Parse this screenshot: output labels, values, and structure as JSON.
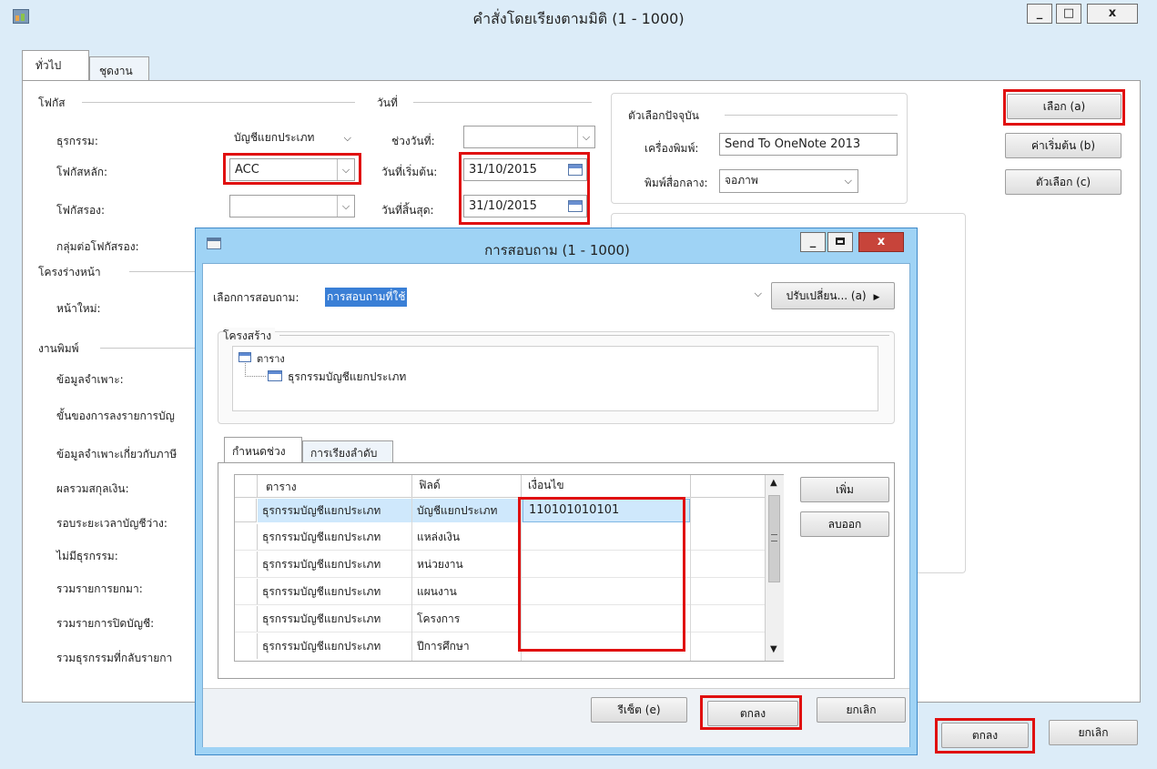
{
  "main_window": {
    "title": "คำสั่งโดยเรียงตามมิติ (1 - 1000)",
    "tabs": [
      "ทั่วไป",
      "ชุดงาน"
    ],
    "focus_group": {
      "title": "โฟกัส",
      "transaction_label": "ธุรกรรม:",
      "transaction_value": "บัญชีแยกประเภท",
      "main_focus_label": "โฟกัสหลัก:",
      "main_focus_value": "ACC",
      "secondary_focus_label": "โฟกัสรอง:",
      "secondary_focus_value": "",
      "sub_focus_group_label": "กลุ่มต่อโฟกัสรอง:"
    },
    "layout_group": {
      "title": "โครงร่างหน้า",
      "new_page_label": "หน้าใหม่:"
    },
    "date_group": {
      "title": "วันที่",
      "interval_label": "ช่วงวันที่:",
      "interval_value": "",
      "start_label": "วันที่เริ่มต้น:",
      "start_value": "31/10/2015",
      "end_label": "วันที่สิ้นสุด:",
      "end_value": "31/10/2015"
    },
    "current_options": {
      "title": "ตัวเลือกปัจจุบัน",
      "printer_label": "เครื่องพิมพ์:",
      "printer_value": "Send To OneNote 2013",
      "print_medium_label": "พิมพ์สื่อกลาง:",
      "print_medium_value": "จอภาพ"
    },
    "print_group": {
      "title": "งานพิมพ์",
      "labels": [
        "ข้อมูลจำเพาะ:",
        "ขั้นของการลงรายการบัญ",
        "ข้อมูลจำเพาะเกี่ยวกับภาษี",
        "ผลรวมสกุลเงิน:",
        "รอบระยะเวลาบัญชีว่าง:",
        "ไม่มีธุรกรรม:",
        "รวมรายการยกมา:",
        "รวมรายการปิดบัญชี:",
        "รวมธุรกรรมที่กลับรายกา"
      ]
    },
    "side_buttons": {
      "select": "เลือก (a)",
      "defaults": "ค่าเริ่มต้น (b)",
      "options": "ตัวเลือก (c)"
    },
    "footer": {
      "ok": "ตกลง",
      "cancel": "ยกเลิก"
    }
  },
  "dialog": {
    "title": "การสอบถาม (1 - 1000)",
    "select_query_label": "เลือกการสอบถาม:",
    "select_query_value": "การสอบถามที่ใช้",
    "modify_button": "ปรับเปลี่ยน... (a)",
    "structure_title": "โครงสร้าง",
    "tree": {
      "root": "ตาราง",
      "child": "ธุรกรรมบัญชีแยกประเภท"
    },
    "tabs": [
      "กำหนดช่วง",
      "การเรียงลำดับ"
    ],
    "grid": {
      "headers": [
        "ตาราง",
        "ฟิลด์",
        "เงื่อนไข"
      ],
      "rows": [
        [
          "ธุรกรรมบัญชีแยกประเภท",
          "บัญชีแยกประเภท",
          "110101010101"
        ],
        [
          "ธุรกรรมบัญชีแยกประเภท",
          "แหล่งเงิน",
          ""
        ],
        [
          "ธุรกรรมบัญชีแยกประเภท",
          "หน่วยงาน",
          ""
        ],
        [
          "ธุรกรรมบัญชีแยกประเภท",
          "แผนงาน",
          ""
        ],
        [
          "ธุรกรรมบัญชีแยกประเภท",
          "โครงการ",
          ""
        ],
        [
          "ธุรกรรมบัญชีแยกประเภท",
          "ปีการศึกษา",
          ""
        ]
      ]
    },
    "add_button": "เพิ่ม",
    "remove_button": "ลบออก",
    "reset_button": "รีเซ็ต (e)",
    "ok_button": "ตกลง",
    "cancel_button": "ยกเลิก"
  },
  "window_controls": {
    "minimize": "_",
    "maximize": "□",
    "close": "x"
  },
  "colors": {
    "title_bar": "#dcecf8",
    "dialog_frame": "#9fd3f5",
    "highlight_red": "#e01010",
    "selection_blue": "#cfe8fc"
  }
}
